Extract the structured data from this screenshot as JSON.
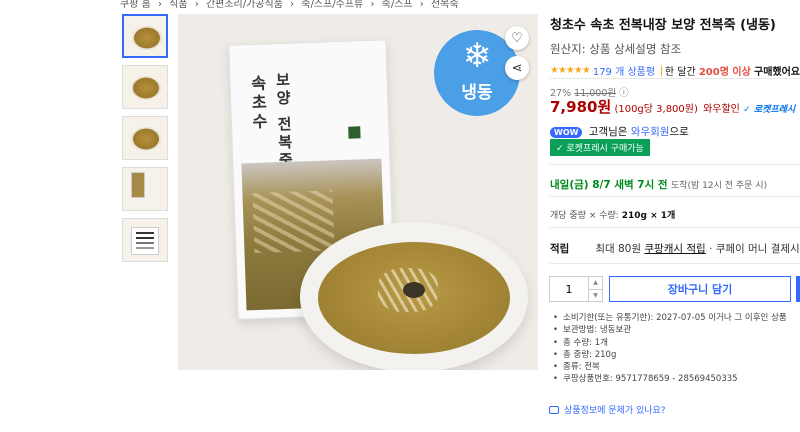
{
  "breadcrumb": [
    "쿠팡 홈",
    "식품",
    "간편조리/가공식품",
    "죽/스프/수프류",
    "죽/스프",
    "전복죽"
  ],
  "thumbnails": [
    {
      "name": "thumb-main"
    },
    {
      "name": "thumb-bowl"
    },
    {
      "name": "thumb-bowl-2"
    },
    {
      "name": "thumb-package"
    },
    {
      "name": "thumb-label"
    }
  ],
  "image": {
    "frozen_label": "냉동",
    "frozen_icon": "snowflake-icon",
    "pouch_title": "보양 전복죽",
    "pouch_brand": "속초수",
    "badge_color": "#4a9fe6"
  },
  "product": {
    "title": "청초수 속초 전복내장 보양 전복죽 (냉동)",
    "origin": "원산지: 상품 상세설명 참조",
    "stars": "★★★★★",
    "review_count": "179 개 상품평",
    "buy_prefix": "한 달간",
    "buy_count": "200명 이상",
    "buy_suffix": "구매했어요"
  },
  "price": {
    "discount_rate": "27%",
    "original_price": "11,000원",
    "sale_price": "7,980원",
    "unit_price": "(100g당 3,800원)",
    "member_price": "와우할인",
    "rocket_label": "로켓프레시"
  },
  "wow": {
    "badge": "WOW",
    "text_prefix": "고객님은",
    "link": "와우회원",
    "text_suffix": "으로",
    "rocket_box": "✓ 로켓프레시 구매가능"
  },
  "delivery": {
    "date": "내일(금) 8/7 새벽 7시 전",
    "label": "도착",
    "note": "(밤 12시 전 주문 시)"
  },
  "weight": {
    "label": "개당 중량 × 수량:",
    "value": "210g × 1개"
  },
  "points": {
    "label": "적립",
    "max": "최대 80원",
    "link": "쿠팡캐시 적립",
    "pay": "· 쿠페이 머니 결제시"
  },
  "quantity": {
    "value": "1"
  },
  "cart": {
    "label": "장바구니 담기"
  },
  "details": [
    "소비기한(또는 유통기한): 2027-07-05 이거나 그 이후인 상품",
    "보관방법: 냉동보관",
    "총 수량: 1개",
    "총 중량: 210g",
    "종류: 전복",
    "쿠팡상품번호: 9571778659 - 28569450335"
  ],
  "report": {
    "label": "상품정보에 문제가 있나요?"
  }
}
